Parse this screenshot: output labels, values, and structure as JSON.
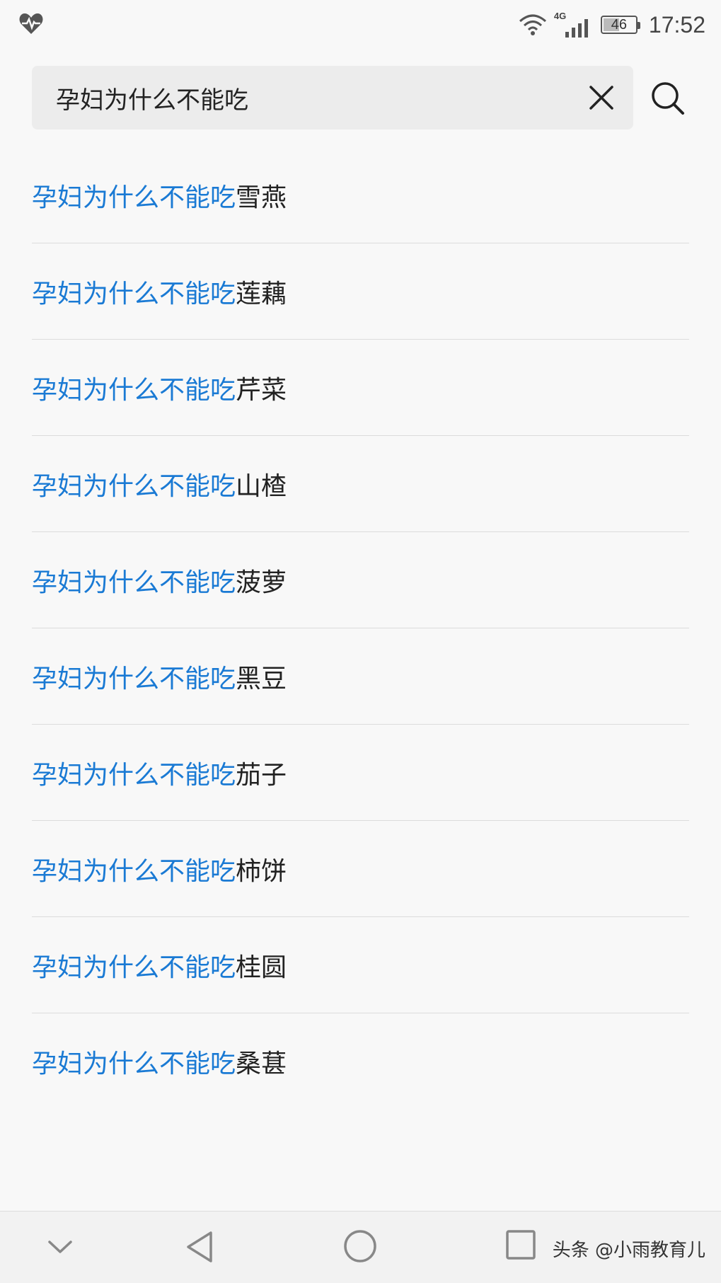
{
  "status_bar": {
    "left_icon": "heart-rate-icon",
    "network": "4G",
    "battery": "46",
    "battery_level": 0.46,
    "time": "17:52"
  },
  "search": {
    "query": "孕妇为什么不能吃",
    "clear_icon": "close-icon",
    "search_icon": "search-icon"
  },
  "suggestions": [
    {
      "match": "孕妇为什么不能吃",
      "rest": "雪燕"
    },
    {
      "match": "孕妇为什么不能吃",
      "rest": "莲藕"
    },
    {
      "match": "孕妇为什么不能吃",
      "rest": "芹菜"
    },
    {
      "match": "孕妇为什么不能吃",
      "rest": "山楂"
    },
    {
      "match": "孕妇为什么不能吃",
      "rest": "菠萝"
    },
    {
      "match": "孕妇为什么不能吃",
      "rest": "黑豆"
    },
    {
      "match": "孕妇为什么不能吃",
      "rest": "茄子"
    },
    {
      "match": "孕妇为什么不能吃",
      "rest": "柿饼"
    },
    {
      "match": "孕妇为什么不能吃",
      "rest": "桂圆"
    },
    {
      "match": "孕妇为什么不能吃",
      "rest": "桑葚"
    }
  ],
  "nav_bar": {
    "icons": [
      "chevron-down-icon",
      "back-triangle-icon",
      "home-circle-icon",
      "recent-square-icon"
    ],
    "watermark": "头条 @小雨教育儿"
  },
  "colors": {
    "match": "#1a7ad4",
    "text": "#222222",
    "background": "#f8f8f8",
    "search_bg": "#ececec"
  }
}
